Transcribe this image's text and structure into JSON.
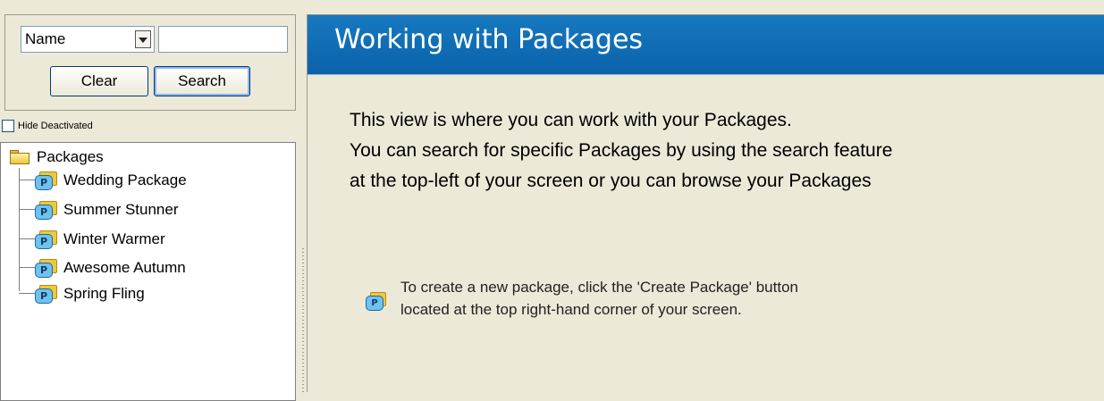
{
  "search": {
    "field_select_value": "Name",
    "input_value": "",
    "clear_label": "Clear",
    "search_label": "Search",
    "hide_deactivated_label": "Hide Deactivated",
    "hide_deactivated_checked": false
  },
  "tree": {
    "root_label": "Packages",
    "items": [
      {
        "label": "Wedding Package",
        "icon": "package-icon"
      },
      {
        "label": "Summer Stunner",
        "icon": "package-icon"
      },
      {
        "label": "Winter Warmer",
        "icon": "package-icon"
      },
      {
        "label": "Awesome Autumn",
        "icon": "package-icon"
      },
      {
        "label": "Spring Fling",
        "icon": "package-icon"
      }
    ]
  },
  "main": {
    "title": "Working with Packages",
    "intro_lines": [
      "This view is where you can work with your Packages.",
      "You can search for specific Packages by using the search feature",
      "at the top-left of your screen or you can browse your Packages"
    ],
    "hint_lines": [
      "To create a new package, click the 'Create Package' button",
      "located at the top right-hand corner of your screen."
    ],
    "icon_letter": "P"
  },
  "colors": {
    "header_blue": "#0a62ab",
    "panel_bg": "#ece9d8",
    "tree_bg": "#ffffff"
  }
}
